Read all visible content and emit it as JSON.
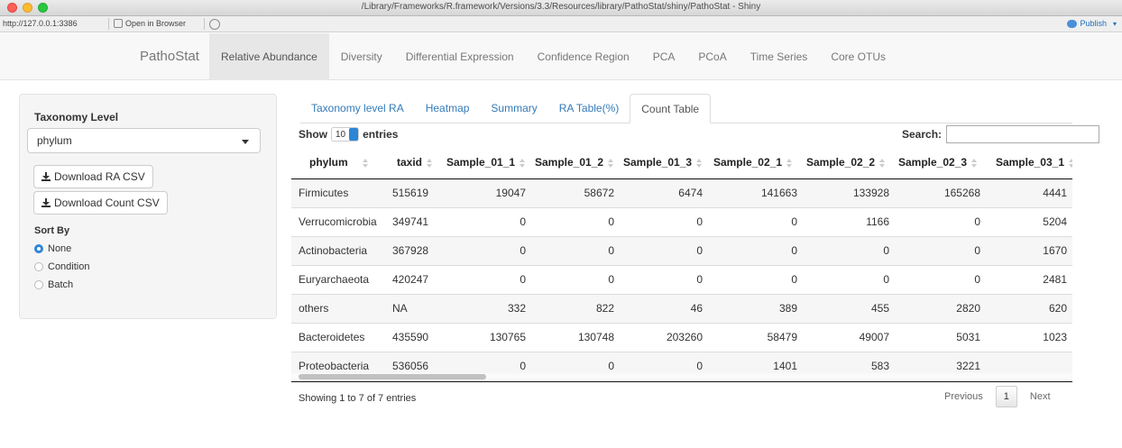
{
  "window": {
    "title": "/Library/Frameworks/R.framework/Versions/3.3/Resources/library/PathoStat/shiny/PathoStat - Shiny"
  },
  "toolbar": {
    "url": "http://127.0.0.1:3386",
    "open_in_browser": "Open in Browser",
    "publish": "Publish"
  },
  "navbar": {
    "brand": "PathoStat",
    "items": [
      {
        "label": "Relative Abundance",
        "active": true
      },
      {
        "label": "Diversity"
      },
      {
        "label": "Differential Expression"
      },
      {
        "label": "Confidence Region"
      },
      {
        "label": "PCA"
      },
      {
        "label": "PCoA"
      },
      {
        "label": "Time Series"
      },
      {
        "label": "Core OTUs"
      }
    ]
  },
  "sidebar": {
    "taxonomy_label": "Taxonomy Level",
    "taxonomy_value": "phylum",
    "download_ra": "Download RA CSV",
    "download_count": "Download Count CSV",
    "sort_label": "Sort By",
    "sort_options": [
      "None",
      "Condition",
      "Batch"
    ],
    "sort_selected": "None"
  },
  "tabs": [
    {
      "label": "Taxonomy level RA"
    },
    {
      "label": "Heatmap"
    },
    {
      "label": "Summary"
    },
    {
      "label": "RA Table(%)"
    },
    {
      "label": "Count Table",
      "active": true
    }
  ],
  "table_controls": {
    "show": "Show",
    "length": "10",
    "entries": "entries",
    "search_label": "Search:"
  },
  "table": {
    "columns": [
      "phylum",
      "taxid",
      "Sample_01_1",
      "Sample_01_2",
      "Sample_01_3",
      "Sample_02_1",
      "Sample_02_2",
      "Sample_02_3",
      "Sample_03_1"
    ],
    "rows": [
      [
        "Firmicutes",
        "515619",
        "19047",
        "58672",
        "6474",
        "141663",
        "133928",
        "165268",
        "4441"
      ],
      [
        "Verrucomicrobia",
        "349741",
        "0",
        "0",
        "0",
        "0",
        "1166",
        "0",
        "5204"
      ],
      [
        "Actinobacteria",
        "367928",
        "0",
        "0",
        "0",
        "0",
        "0",
        "0",
        "1670"
      ],
      [
        "Euryarchaeota",
        "420247",
        "0",
        "0",
        "0",
        "0",
        "0",
        "0",
        "2481"
      ],
      [
        "others",
        "NA",
        "332",
        "822",
        "46",
        "389",
        "455",
        "2820",
        "620"
      ],
      [
        "Bacteroidetes",
        "435590",
        "130765",
        "130748",
        "203260",
        "58479",
        "49007",
        "5031",
        "1023"
      ],
      [
        "Proteobacteria",
        "536056",
        "0",
        "0",
        "0",
        "1401",
        "583",
        "3221",
        ""
      ]
    ]
  },
  "footer": {
    "info": "Showing 1 to 7 of 7 entries",
    "previous": "Previous",
    "page": "1",
    "next": "Next"
  }
}
